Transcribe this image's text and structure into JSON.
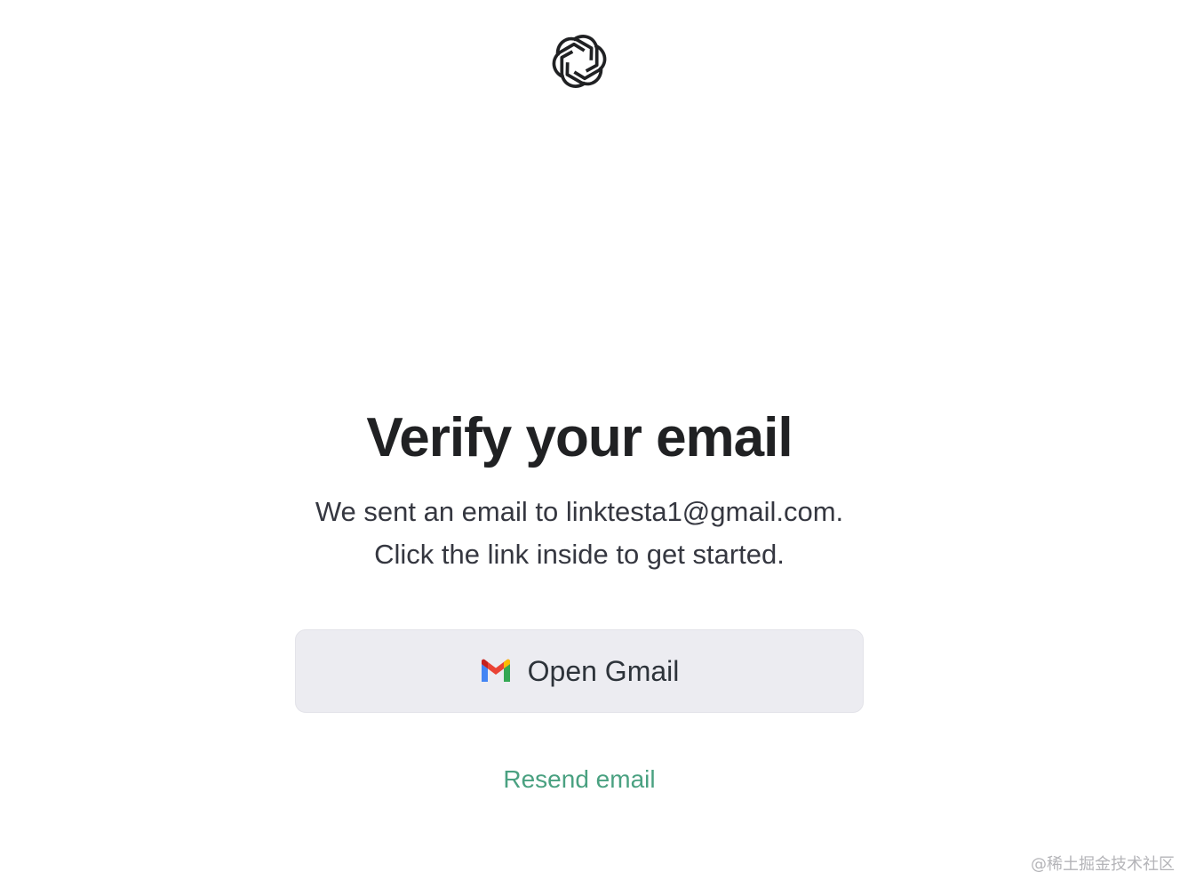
{
  "logo": {
    "icon": "openai-logo-icon"
  },
  "heading": {
    "title": "Verify your email"
  },
  "message": {
    "line1": "We sent an email to linktesta1@gmail.com.",
    "line2": "Click the link inside to get started."
  },
  "actions": {
    "open_gmail_label": "Open Gmail",
    "open_gmail_icon": "gmail-icon",
    "resend_label": "Resend email"
  },
  "watermark": {
    "text": "@稀土掘金技术社区"
  },
  "colors": {
    "accent": "#10a37f",
    "button_bg": "#ececf1",
    "text": "#202123"
  }
}
